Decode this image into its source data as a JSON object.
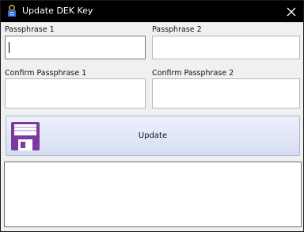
{
  "window": {
    "title": "Update DEK Key",
    "app_icon": "key-chain-icon",
    "close_icon": "close-icon"
  },
  "fields": {
    "passphrase1": {
      "label": "Passphrase 1",
      "value": ""
    },
    "passphrase2": {
      "label": "Passphrase 2",
      "value": ""
    },
    "confirm1": {
      "label": "Confirm Passphrase 1",
      "value": ""
    },
    "confirm2": {
      "label": "Confirm Passphrase 2",
      "value": ""
    }
  },
  "update_button": {
    "label": "Update",
    "icon": "floppy-disk-icon",
    "icon_color": "#7b3aa0"
  },
  "output": {
    "text": ""
  },
  "colors": {
    "titlebar": "#000000",
    "button_gradient_top": "#eef1fb",
    "button_gradient_bottom": "#d6ddf4"
  }
}
